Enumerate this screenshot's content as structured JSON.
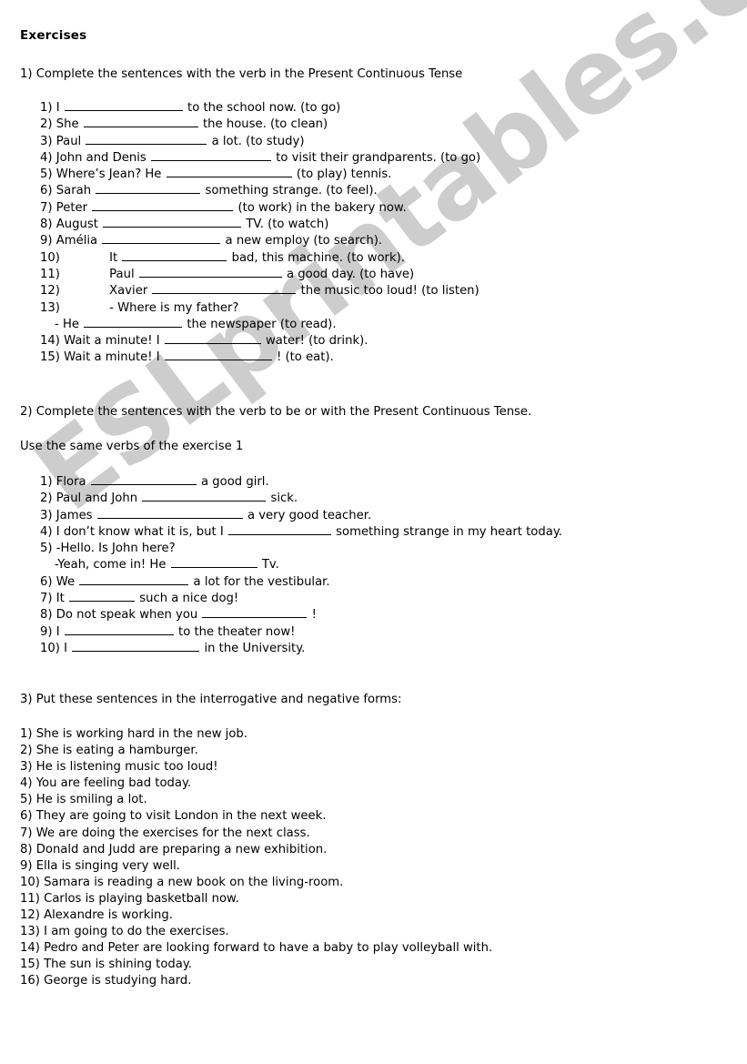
{
  "document": {
    "title": "Exercises",
    "watermark": "ESLprintables.com",
    "watermark_color": "#cdcdcd",
    "page_background": "#ffffff",
    "text_color": "#000000"
  },
  "exercise1": {
    "heading": "1) Complete the sentences with the verb in the Present Continuous Tense",
    "items": [
      {
        "num": "1)",
        "before": "I",
        "blank": 130,
        "after": "to the school now. (to go)"
      },
      {
        "num": "2)",
        "before": "She",
        "blank": 126,
        "after": "the house. (to clean)"
      },
      {
        "num": "3)",
        "before": "Paul",
        "blank": 133,
        "after": "a lot. (to study)"
      },
      {
        "num": "4)",
        "before": "John and Denis",
        "blank": 132,
        "after": "to visit their grandparents. (to go)"
      },
      {
        "num": "5)",
        "before": "Where’s Jean? He",
        "blank": 138,
        "after": "(to play) tennis."
      },
      {
        "num": "6)",
        "before": "Sarah",
        "blank": 115,
        "after": "something strange. (to feel)."
      },
      {
        "num": "7)",
        "before": "Peter",
        "blank": 155,
        "after": "(to work) in the bakery now."
      },
      {
        "num": "8)",
        "before": "August",
        "blank": 152,
        "after": "TV. (to watch)"
      },
      {
        "num": "9)",
        "before": "Amélia",
        "blank": 130,
        "after": "a new employ (to search)."
      },
      {
        "num": "10)",
        "before": "It",
        "blank": 115,
        "after": "bad, this machine. (to work).",
        "tab": true
      },
      {
        "num": "11)",
        "before": "Paul",
        "blank": 157,
        "after": "a good day. (to have)",
        "tab": true
      },
      {
        "num": "12)",
        "before": "Xavier",
        "blank": 158,
        "after": "the music too loud! (to listen)",
        "tab": true
      },
      {
        "num": "13)",
        "before": "- Where is my father?",
        "blank": 0,
        "after": "",
        "tab": true
      },
      {
        "num": "",
        "before": "- He",
        "blank": 108,
        "after": "the newspaper (to read).",
        "dash_indent": true
      },
      {
        "num": "14)",
        "before": "Wait a minute! I",
        "blank": 106,
        "after": "water! (to drink)."
      },
      {
        "num": "15)",
        "before": "Wait a minute! I",
        "blank": 118,
        "after": "! (to eat)."
      }
    ]
  },
  "exercise2": {
    "heading": "2) Complete the sentences with the verb to be or with the Present Continuous Tense.",
    "note": "Use the same verbs of the exercise 1",
    "items": [
      {
        "num": "1)",
        "before": "Flora",
        "blank": 116,
        "after": "a good girl."
      },
      {
        "num": "2)",
        "before": "Paul and John",
        "blank": 136,
        "after": "sick."
      },
      {
        "num": "3)",
        "before": "James",
        "blank": 160,
        "after": "a very good teacher."
      },
      {
        "num": "4)",
        "before": "I don’t know what it is, but I",
        "blank": 113,
        "after": "something strange in my heart today."
      },
      {
        "num": "5)",
        "before": "-Hello. Is John here?",
        "blank": 0,
        "after": ""
      },
      {
        "num": "",
        "before": "-Yeah, come in! He",
        "blank": 95,
        "after": "Tv.",
        "dash_indent": true
      },
      {
        "num": "6)",
        "before": "We",
        "blank": 120,
        "after": "a lot for the vestibular."
      },
      {
        "num": "7)",
        "before": "It",
        "blank": 72,
        "after": "such a nice dog!"
      },
      {
        "num": "8)",
        "before": "Do not speak when you",
        "blank": 115,
        "after": "!"
      },
      {
        "num": "9)",
        "before": "I",
        "blank": 120,
        "after": "to the theater now!"
      },
      {
        "num": "10)",
        "before": "I",
        "blank": 140,
        "after": "in the University."
      }
    ]
  },
  "exercise3": {
    "heading": "3) Put these sentences in the interrogative and negative forms:",
    "items": [
      "1) She is working hard in the new job.",
      "2) She is eating a hamburger.",
      "3) He is listening music too loud!",
      "4) You are feeling bad today.",
      "5) He is smiling a lot.",
      "6) They are going to visit London in the next week.",
      "7) We are doing the exercises for the next class.",
      "8) Donald and Judd are preparing a new exhibition.",
      "9) Ella is singing very well.",
      "10) Samara is reading a new book on the living-room.",
      "11) Carlos is playing basketball now.",
      "12) Alexandre is working.",
      "13) I am going to do the exercises.",
      "14) Pedro and Peter are looking forward to have a baby to play volleyball with.",
      "15) The sun is shining today.",
      "16) George is studying hard."
    ]
  }
}
